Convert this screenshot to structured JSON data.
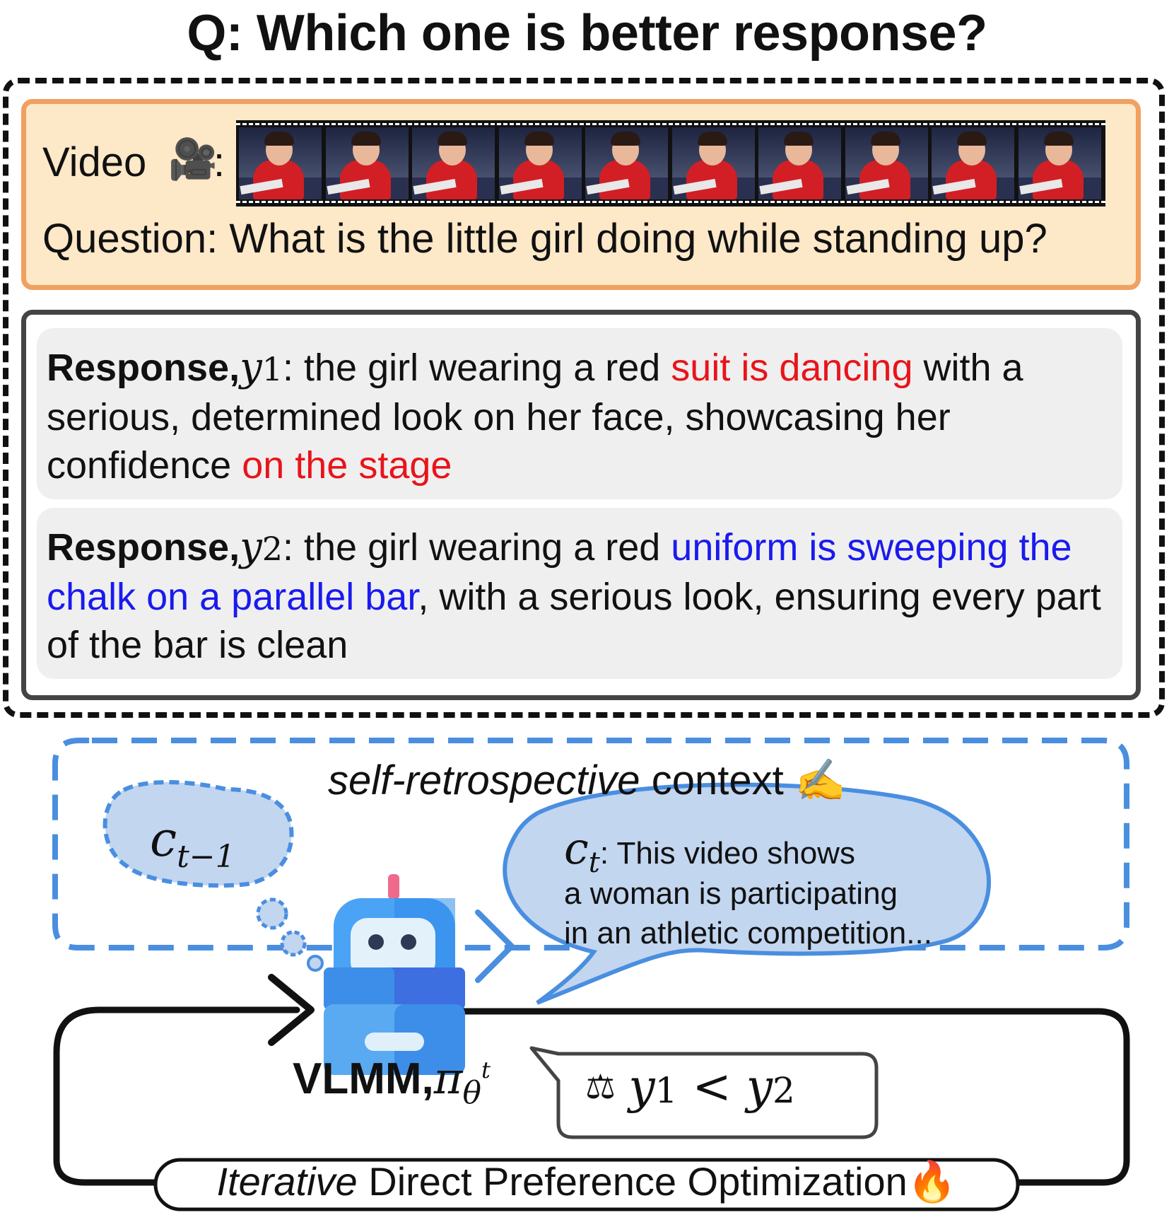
{
  "title": "Q: Which one is better response?",
  "input": {
    "video_label": "Video",
    "video_icon": "🎥",
    "colon": ":",
    "question": "Question: What is the little girl doing while standing up?",
    "frames": 10
  },
  "responses": [
    {
      "label": "Response,",
      "symbol": "𝑦",
      "index": "1",
      "segments": [
        {
          "text": ": the girl wearing a red ",
          "color": "normal"
        },
        {
          "text": "suit is dancing",
          "color": "red"
        },
        {
          "text": " with a serious, determined look on her face, showcasing her confidence ",
          "color": "normal"
        },
        {
          "text": "on the stage",
          "color": "red"
        }
      ]
    },
    {
      "label": "Response,",
      "symbol": "𝑦",
      "index": "2",
      "segments": [
        {
          "text": ": the girl wearing a red ",
          "color": "normal"
        },
        {
          "text": "uniform is sweeping the chalk on a parallel bar",
          "color": "blue"
        },
        {
          "text": ", with a serious look, ensuring every part of the bar is clean",
          "color": "normal"
        }
      ]
    }
  ],
  "context": {
    "label_italic": "self-retrospective",
    "label_rest": " context ✍",
    "prev": "c",
    "prev_sub": "t−1",
    "curr": "c",
    "curr_sub": "t",
    "curr_text_1": ": This video shows",
    "curr_text_2": "a woman is participating",
    "curr_text_3": "in an athletic competition..."
  },
  "model": {
    "name": "VLMM,",
    "symbol": "π",
    "sub": "θ",
    "sup": "t"
  },
  "preference": {
    "icon": "⚖",
    "lhs": "y",
    "lhs_sub": "1",
    "op": " < ",
    "rhs": "y",
    "rhs_sub": "2"
  },
  "loop": {
    "label_italic": "Iterative",
    "label_rest": " Direct Preference Optimization🔥"
  },
  "colors": {
    "input_fill": "#fde8c8",
    "input_border": "#f0a060",
    "response_fill": "#efefef",
    "wrong": "#e8141b",
    "right": "#1a1aee",
    "context_border": "#4a8ee0",
    "bubble_fill": "#c2d6f0"
  }
}
